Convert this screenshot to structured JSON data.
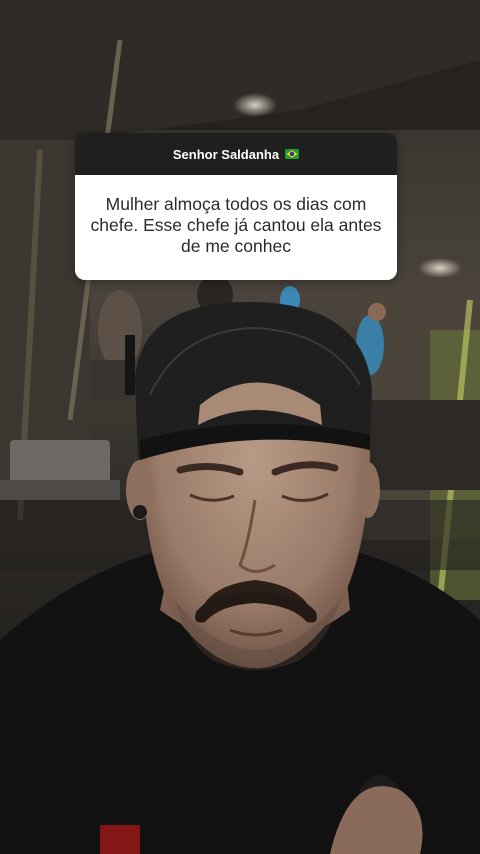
{
  "question_sticker": {
    "author": "Senhor Saldanha",
    "author_flag_icon": "brazil-flag-icon",
    "question": "Mulher almoça todos os dias com chefe. Esse chefe já cantou ela antes de me conhec"
  },
  "colors": {
    "card_header_bg": "#1f1f1f",
    "card_body_bg": "#ffffff",
    "question_text": "#2b2b2b",
    "flag_green": "#1f9a3b",
    "flag_yellow": "#f4d21f",
    "flag_blue": "#1e3f8a"
  }
}
